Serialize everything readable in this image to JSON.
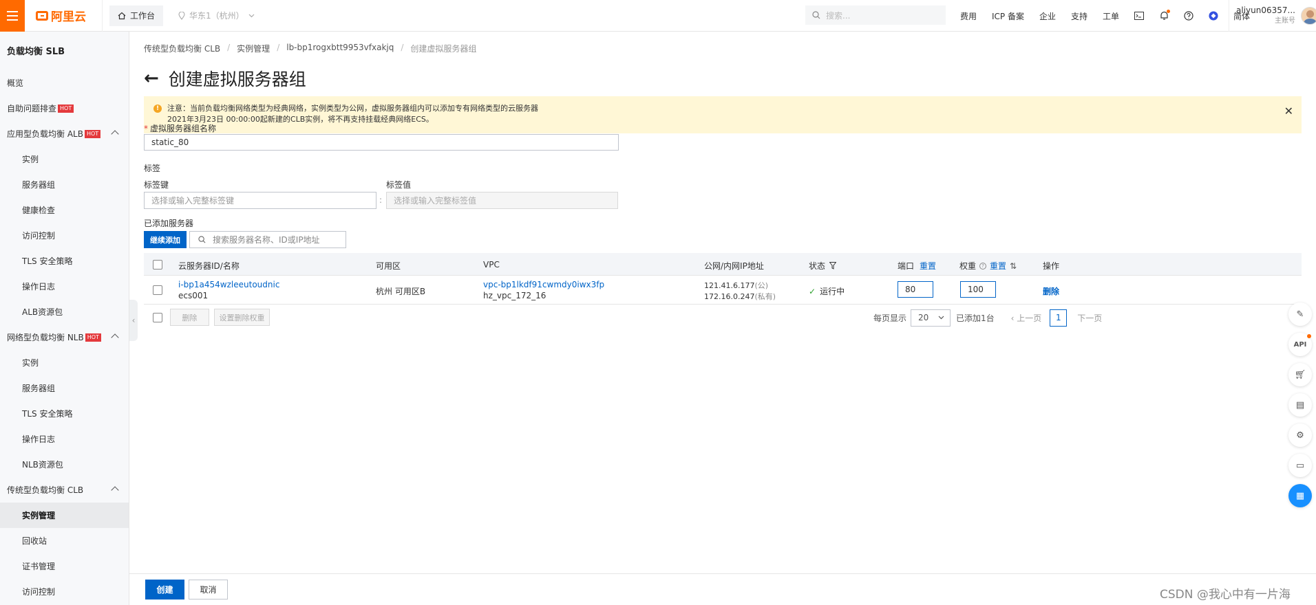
{
  "topbar": {
    "logo": "阿里云",
    "workbench": "工作台",
    "region": "华东1（杭州）",
    "search_placeholder": "搜索...",
    "links": [
      "费用",
      "ICP 备案",
      "企业",
      "支持",
      "工单"
    ],
    "lang": "简体",
    "user_name": "aliyun06357...",
    "user_role": "主账号"
  },
  "sidebar": {
    "title": "负载均衡 SLB",
    "overview": "概览",
    "diagnose": "自助问题排查",
    "alb_group": "应用型负载均衡 ALB",
    "alb_items": [
      "实例",
      "服务器组",
      "健康检查",
      "访问控制",
      "TLS 安全策略",
      "操作日志",
      "ALB资源包"
    ],
    "nlb_group": "网络型负载均衡 NLB",
    "nlb_items": [
      "实例",
      "服务器组",
      "TLS 安全策略",
      "操作日志",
      "NLB资源包"
    ],
    "clb_group": "传统型负载均衡 CLB",
    "clb_items": [
      "实例管理",
      "回收站",
      "证书管理",
      "访问控制"
    ],
    "hot_badge": "HOT"
  },
  "breadcrumb": [
    "传统型负载均衡 CLB",
    "实例管理",
    "lb-bp1rogxbtt9953vfxakjq",
    "创建虚拟服务器组"
  ],
  "page": {
    "title": "创建虚拟服务器组",
    "notice_line1": "注意：当前负载均衡网络类型为经典网络，实例类型为公网，虚拟服务器组内可以添加专有网络类型的云服务器",
    "notice_line2": "2021年3月23日 00:00:00起新建的CLB实例，将不再支持挂载经典网络ECS。",
    "group_name_label": "虚拟服务器组名称",
    "group_name_value": "static_80",
    "tag_label": "标签",
    "tag_key_label": "标签键",
    "tag_key_placeholder": "选择或输入完整标签键",
    "tag_value_label": "标签值",
    "tag_value_placeholder": "选择或输入完整标签值",
    "added_servers_label": "已添加服务器",
    "continue_add": "继续添加",
    "server_search_placeholder": "搜索服务器名称、ID或IP地址"
  },
  "table": {
    "headers": {
      "server": "云服务器ID/名称",
      "zone": "可用区",
      "vpc": "VPC",
      "ip": "公网/内网IP地址",
      "status": "状态",
      "port": "端口",
      "weight": "权重",
      "reset": "重置",
      "action": "操作"
    },
    "rows": [
      {
        "server_id": "i-bp1a454wzleeutoudnic",
        "server_name": "ecs001",
        "zone": "杭州 可用区B",
        "vpc_id": "vpc-bp1lkdf91cwmdy0iwx3fp",
        "vpc_name": "hz_vpc_172_16",
        "public_ip": "121.41.6.177",
        "public_tag": "(公)",
        "private_ip": "172.16.0.247",
        "private_tag": "(私有)",
        "status": "运行中",
        "port": "80",
        "weight": "100",
        "action": "删除"
      }
    ]
  },
  "footer": {
    "delete": "删除",
    "set_weight": "设置删除权重",
    "per_page_label": "每页显示",
    "per_page": "20",
    "added_count": "已添加1台",
    "prev": "上一页",
    "page": "1",
    "next": "下一页"
  },
  "bottom": {
    "create": "创建",
    "cancel": "取消"
  },
  "float": {
    "api": "API"
  },
  "watermark": "CSDN @我心中有一片海",
  "colors": {
    "brand": "#ff6a00",
    "primary": "#0064c8",
    "notice_bg": "#fff7d6",
    "hot": "#e4393c"
  }
}
